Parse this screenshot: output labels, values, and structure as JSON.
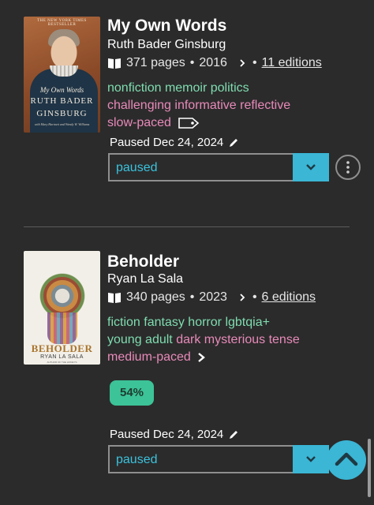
{
  "books": [
    {
      "title": "My Own Words",
      "author": "Ruth Bader Ginsburg",
      "pages": "371 pages",
      "year": "2016",
      "editions": "11 editions",
      "genres": [
        "nonfiction",
        "memoir",
        "politics"
      ],
      "moods": [
        "challenging",
        "informative",
        "reflective"
      ],
      "pace": "slow-paced",
      "status_line": "Paused Dec 24, 2024",
      "status_value": "paused",
      "cover": {
        "banner": "THE NEW YORK TIMES BESTSELLER",
        "title_line1": "My Own Words",
        "title_line2": "RUTH BADER",
        "title_line3": "GINSBURG",
        "byline": "with Mary Hartnett and Wendy W. Williams"
      }
    },
    {
      "title": "Beholder",
      "author": "Ryan La Sala",
      "pages": "340 pages",
      "year": "2023",
      "editions": "6 editions",
      "genres_line1": [
        "fiction",
        "fantasy",
        "horror",
        "lgbtqia+"
      ],
      "genres_line2": [
        "young adult"
      ],
      "moods": [
        "dark",
        "mysterious",
        "tense"
      ],
      "pace": "medium-paced",
      "progress": "54%",
      "status_line": "Paused Dec 24, 2024",
      "status_value": "paused",
      "cover": {
        "title": "BEHOLDER",
        "author": "RYAN LA SALA",
        "sub": "AUTHOR OF THE HONEYS"
      }
    }
  ],
  "colors": {
    "background": "#2b2b2b",
    "genre": "#7fdcb0",
    "mood": "#e88ab9",
    "accent": "#3bb6d5",
    "progress": "#3cc397"
  },
  "icons": [
    "book-icon",
    "chevron-right-icon",
    "tag-icon",
    "pencil-icon",
    "chevron-down-icon",
    "more-icon",
    "chevron-up-icon"
  ]
}
